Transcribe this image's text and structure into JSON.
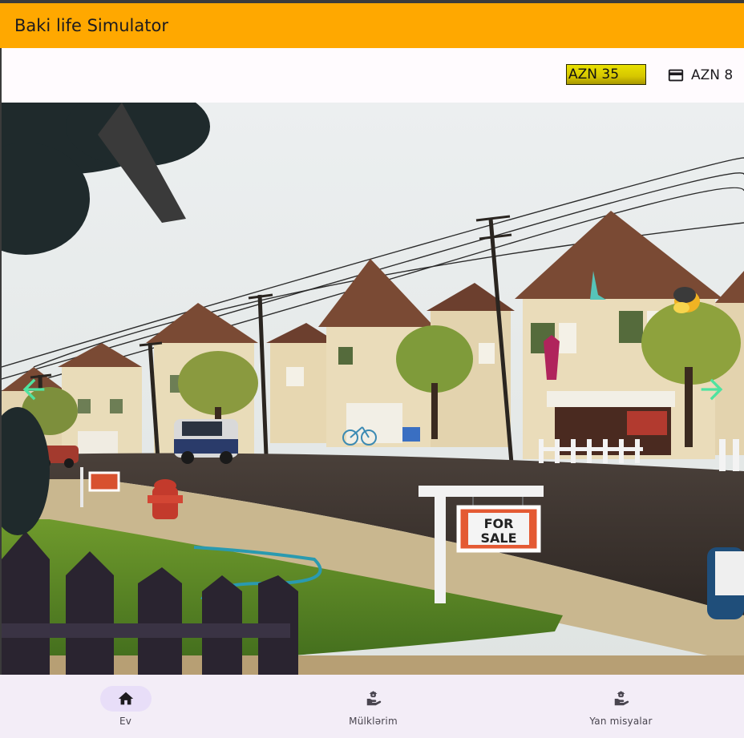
{
  "app": {
    "title": "Baki life Simulator"
  },
  "status": {
    "cash": "AZN 35",
    "card_balance": "AZN 8",
    "card_icon": "credit-card-icon"
  },
  "scene": {
    "sign_line1": "FOR",
    "sign_line2": "SALE",
    "left_arrow_icon": "arrow-left-icon",
    "right_arrow_icon": "arrow-right-icon",
    "arrow_color": "#4fe3a0"
  },
  "bottom_nav": {
    "items": [
      {
        "label": "Ev",
        "icon": "home-icon",
        "active": true
      },
      {
        "label": "Mülklərim",
        "icon": "property-hand-icon",
        "active": false
      },
      {
        "label": "Yan misyalar",
        "icon": "property-hand-icon",
        "active": false
      }
    ]
  },
  "colors": {
    "appbar": "#ffa800",
    "nav_background": "#f3edf7",
    "active_pill": "#e8def8"
  }
}
